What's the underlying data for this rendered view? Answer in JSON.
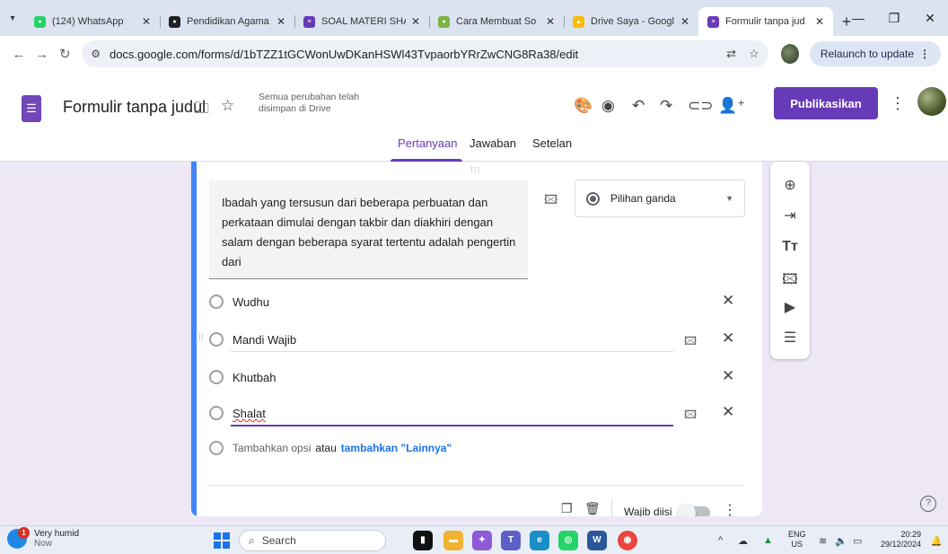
{
  "browser": {
    "tabs": [
      {
        "label": "(124) WhatsApp",
        "icon": "whatsapp-icon",
        "color": "#25d366"
      },
      {
        "label": "Pendidikan Agama",
        "icon": "site-icon",
        "color": "#202124"
      },
      {
        "label": "SOAL MATERI SHA",
        "icon": "forms-icon",
        "color": "#673ab7"
      },
      {
        "label": "Cara Membuat So",
        "icon": "site-icon",
        "color": "#7cb342"
      },
      {
        "label": "Drive Saya - Googl",
        "icon": "drive-icon",
        "color": "#fbbc04"
      },
      {
        "label": "Formulir tanpa jud",
        "icon": "forms-icon",
        "color": "#673ab7"
      }
    ],
    "url": "docs.google.com/forms/d/1bTZZ1tGCWonUwDKanHSWl43TvpaorbYRrZwCNG8Ra38/edit",
    "relaunch_label": "Relaunch to update"
  },
  "form": {
    "title": "Formulir tanpa judul",
    "save_status": "Semua perubahan telah disimpan di Drive",
    "publish_label": "Publikasikan",
    "tabs": [
      {
        "label": "Pertanyaan"
      },
      {
        "label": "Jawaban"
      },
      {
        "label": "Setelan"
      }
    ]
  },
  "question": {
    "text": "Ibadah yang tersusun dari beberapa perbuatan dan perkataan dimulai dengan takbir dan diakhiri dengan salam dengan beberapa syarat tertentu adalah pengertin dari",
    "type_label": "Pilihan ganda",
    "options": [
      {
        "label": "Wudhu"
      },
      {
        "label": "Mandi Wajib"
      },
      {
        "label": "Khutbah"
      },
      {
        "label": "Shalat"
      }
    ],
    "add_option_label": "Tambahkan opsi",
    "or_label": "atau",
    "add_other_label": "tambahkan \"Lainnya\"",
    "required_label": "Wajib diisi",
    "required": false
  },
  "taskbar": {
    "weather_title": "Very humid",
    "weather_sub": "Now",
    "weather_badge": "1",
    "search_label": "Search",
    "lang_top": "ENG",
    "lang_bottom": "US",
    "time": "20:29",
    "date": "29/12/2024"
  },
  "colors": {
    "accent": "#673ab7",
    "card_accent": "#4285f4",
    "link": "#1a73e8"
  }
}
